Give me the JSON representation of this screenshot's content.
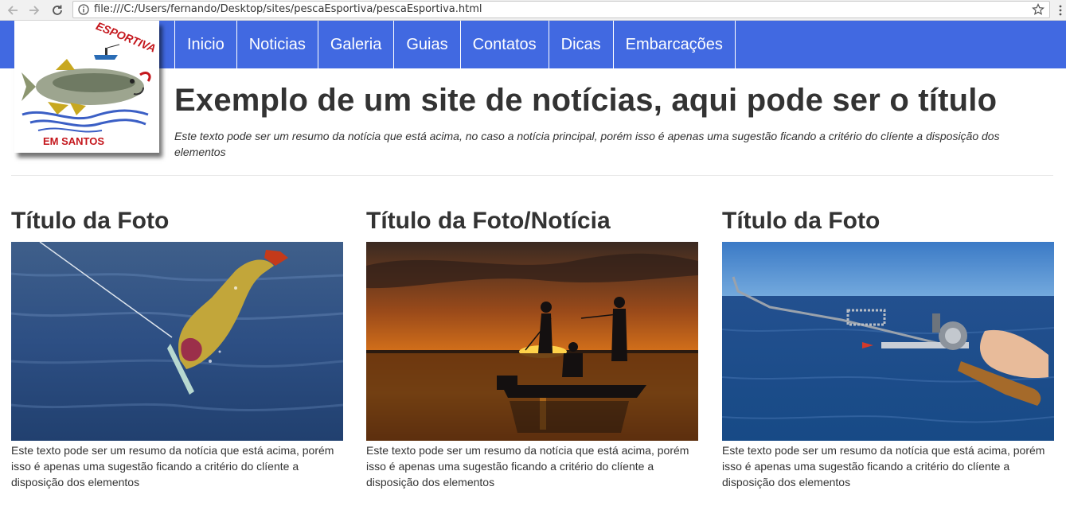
{
  "browser": {
    "url": "file:///C:/Users/fernando/Desktop/sites/pescaEsportiva/pescaEsportiva.html"
  },
  "logo": {
    "text_top": "ESPORTIVA",
    "text_bottom": "EM SANTOS"
  },
  "nav": {
    "items": [
      "Inicio",
      "Noticias",
      "Galeria",
      "Guias",
      "Contatos",
      "Dicas",
      "Embarcações"
    ]
  },
  "header": {
    "title": "Exemplo de um site de notícias, aqui pode ser o título",
    "lead": "Este texto pode ser um resumo da notícia que está acima, no caso a notícia principal, porém isso é apenas uma sugestão ficando a critério do clíente a disposição dos elementos"
  },
  "cards": [
    {
      "title": "Título da Foto",
      "text": "Este texto pode ser um resumo da notícia que está acima, porém isso é apenas uma sugestão ficando a critério do clíente a disposição dos elementos"
    },
    {
      "title": "Título da Foto/Notícia",
      "text": "Este texto pode ser um resumo da notícia que está acima, porém isso é apenas uma sugestão ficando a critério do clíente a disposição dos elementos"
    },
    {
      "title": "Título da Foto",
      "text": "Este texto pode ser um resumo da notícia que está acima, porém isso é apenas uma sugestão ficando a critério do clíente a disposição dos elementos"
    }
  ],
  "colors": {
    "nav_background": "#4169e1",
    "text": "#333333"
  }
}
